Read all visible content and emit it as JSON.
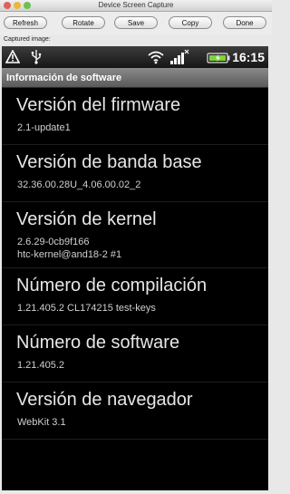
{
  "window": {
    "title": "Device Screen Capture"
  },
  "toolbar": {
    "refresh": "Refresh",
    "rotate": "Rotate",
    "save": "Save",
    "copy": "Copy",
    "done": "Done"
  },
  "capture_label": "Captured image:",
  "status_bar": {
    "icons": [
      "warning-icon",
      "usb-icon",
      "wifi-icon",
      "signal-icon",
      "battery-icon"
    ],
    "time": "16:15"
  },
  "header": {
    "title": "Información de software"
  },
  "items": [
    {
      "title": "Versión del firmware",
      "values": [
        "2.1-update1"
      ]
    },
    {
      "title": "Versión de banda base",
      "values": [
        "32.36.00.28U_4.06.00.02_2"
      ]
    },
    {
      "title": "Versión de kernel",
      "values": [
        "2.6.29-0cb9f166",
        "htc-kernel@and18-2 #1"
      ]
    },
    {
      "title": "Número de compilación",
      "values": [
        "1.21.405.2 CL174215 test-keys"
      ]
    },
    {
      "title": "Número de software",
      "values": [
        "1.21.405.2"
      ]
    },
    {
      "title": "Versión de navegador",
      "values": [
        "WebKit 3.1"
      ]
    }
  ]
}
